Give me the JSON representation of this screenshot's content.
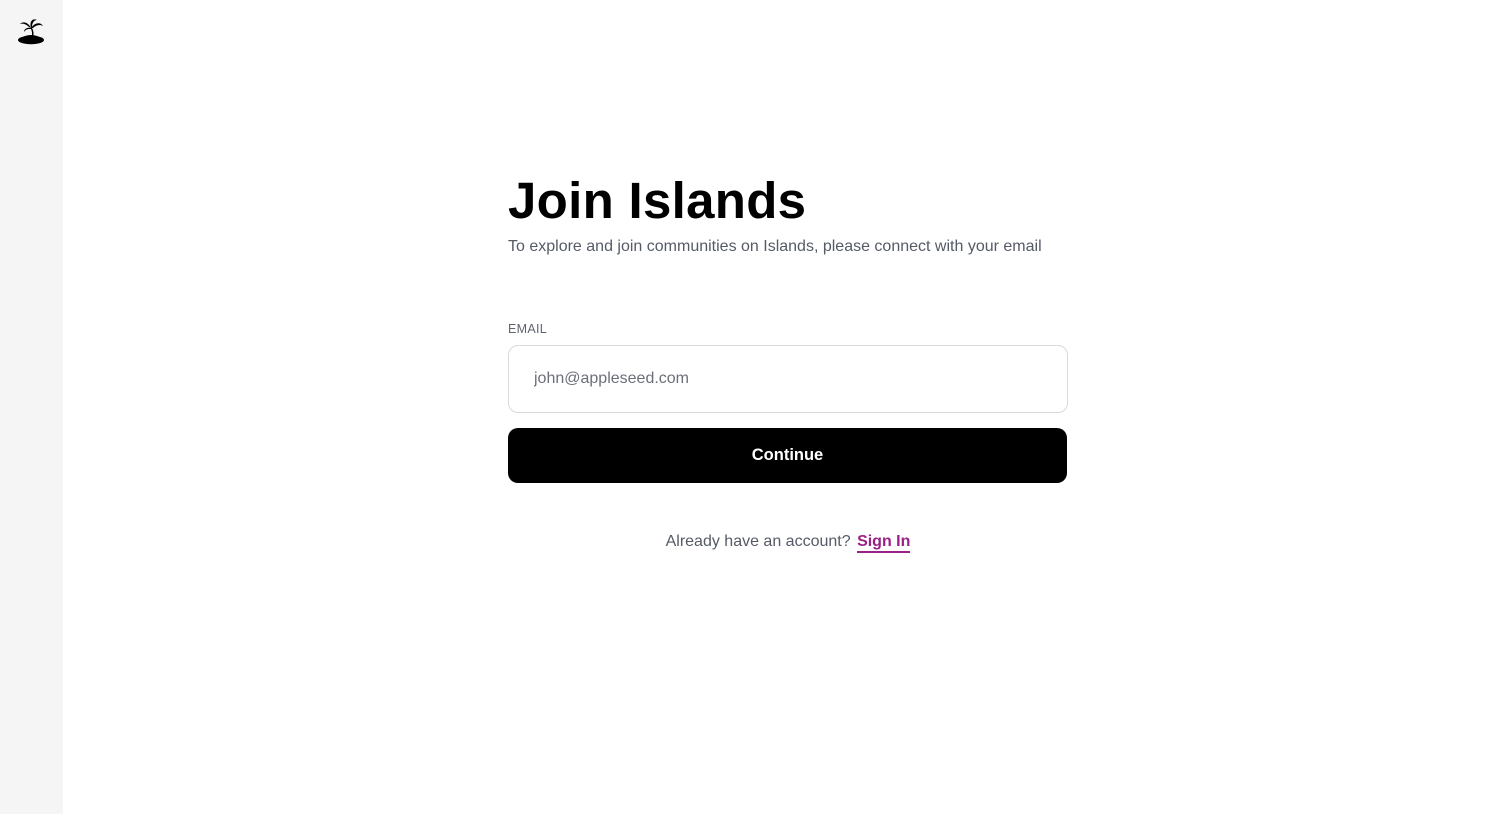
{
  "sidebar": {
    "logo_icon": "palm-island-icon"
  },
  "main": {
    "title": "Join Islands",
    "subtitle": "To explore and join communities on Islands, please connect with your email",
    "email_label": "EMAIL",
    "email_placeholder": "john@appleseed.com",
    "email_value": "",
    "continue_label": "Continue",
    "signin_prompt": "Already have an account?",
    "signin_link": "Sign In"
  },
  "colors": {
    "sidebar_bg": "#f5f5f5",
    "button_bg": "#000000",
    "button_text": "#ffffff",
    "link": "#9a1f86",
    "muted_text": "#555b66"
  }
}
